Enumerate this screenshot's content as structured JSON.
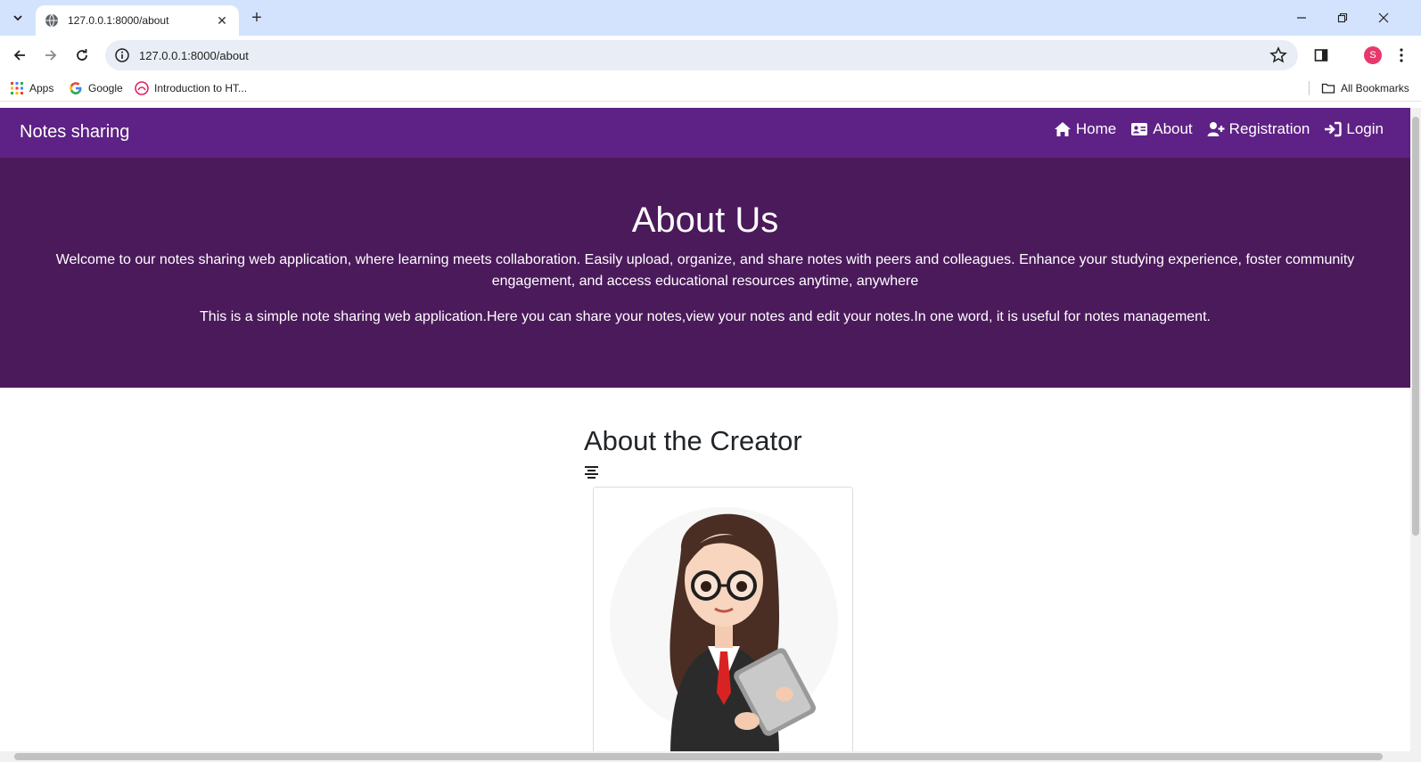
{
  "browser": {
    "tab_title": "127.0.0.1:8000/about",
    "url": "127.0.0.1:8000/about",
    "profile_initial": "S",
    "bookmarks": {
      "apps": "Apps",
      "google": "Google",
      "intro": "Introduction to HT...",
      "all": "All Bookmarks"
    }
  },
  "site": {
    "brand": "Notes sharing",
    "nav": [
      {
        "label": "Home",
        "icon": "house-icon"
      },
      {
        "label": "About",
        "icon": "id-card-icon"
      },
      {
        "label": "Registration",
        "icon": "user-plus-icon"
      },
      {
        "label": "Login",
        "icon": "sign-in-icon"
      }
    ],
    "colors": {
      "nav_bg": "#5e2185",
      "hero_bg": "#4b1a5b"
    }
  },
  "hero": {
    "title": "About Us",
    "paragraph1": "Welcome to our notes sharing web application, where learning meets collaboration. Easily upload, organize, and share notes with peers and colleagues. Enhance your studying experience, foster community engagement, and access educational resources anytime, anywhere",
    "paragraph2": "This is a simple note sharing web application.Here you can share your notes,view your notes and edit your notes.In one word, it is useful for notes management."
  },
  "creator": {
    "title": "About the Creator",
    "photo_icon": "creator-avatar-image"
  }
}
